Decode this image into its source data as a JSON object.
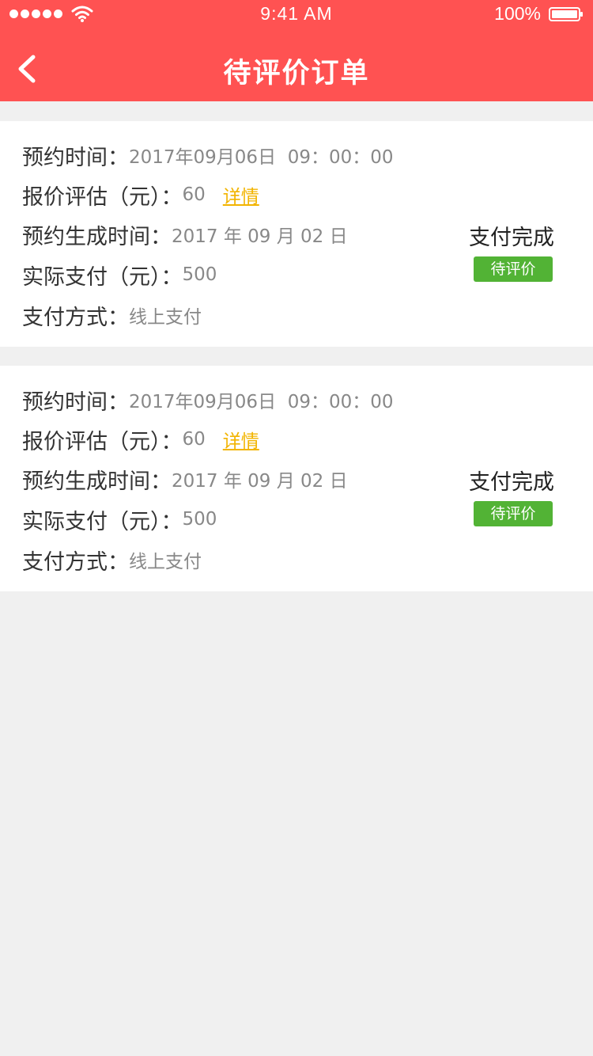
{
  "status_bar": {
    "time": "9:41 AM",
    "battery": "100%"
  },
  "nav": {
    "title": "待评价订单"
  },
  "orders": [
    {
      "appointment_label": "预约时间：",
      "appointment_value": "2017年09月06日  09：00：00",
      "quote_label": "报价评估（元）：",
      "quote_value": "60",
      "detail_link": "详情",
      "created_label": "预约生成时间：",
      "created_value": "2017 年 09 月 02 日",
      "paid_label": "实际支付（元）：",
      "paid_value": "500",
      "method_label": "支付方式：",
      "method_value": "线上支付",
      "status": "支付完成",
      "action": "待评价"
    },
    {
      "appointment_label": "预约时间：",
      "appointment_value": "2017年09月06日  09：00：00",
      "quote_label": "报价评估（元）：",
      "quote_value": "60",
      "detail_link": "详情",
      "created_label": "预约生成时间：",
      "created_value": "2017 年 09 月 02 日",
      "paid_label": "实际支付（元）：",
      "paid_value": "500",
      "method_label": "支付方式：",
      "method_value": "线上支付",
      "status": "支付完成",
      "action": "待评价"
    }
  ],
  "colors": {
    "header": "#ff5252",
    "page_background": "#f0f0f0",
    "link": "#f2b400",
    "review_button": "#52b335"
  },
  "icons": {
    "back": "chevron-left-icon",
    "wifi": "wifi-icon",
    "battery": "battery-icon",
    "signal": "signal-dots-icon"
  }
}
